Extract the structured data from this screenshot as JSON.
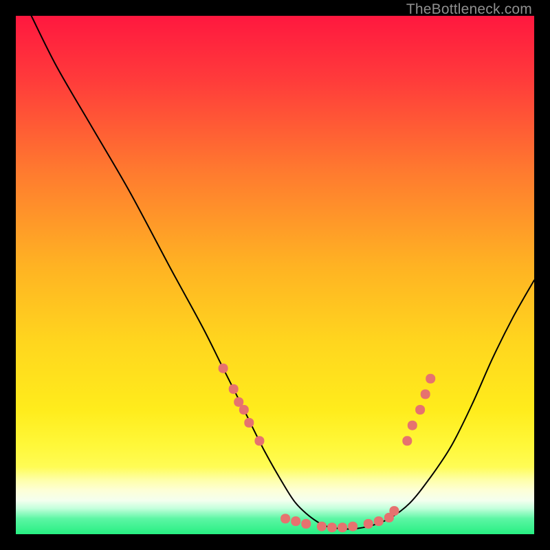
{
  "watermark": "TheBottleneck.com",
  "colors": {
    "background": "#000000",
    "gradient_top": "#ff183f",
    "gradient_mid1": "#ff6b2e",
    "gradient_mid2": "#ffc21f",
    "gradient_mid3": "#ffe61a",
    "gradient_bottom_yellow": "#fffc55",
    "gradient_pale": "#fdffd6",
    "gradient_green": "#27ef82",
    "curve_stroke": "#000000",
    "marker_fill": "#e6726f"
  },
  "chart_data": {
    "type": "line",
    "title": "",
    "xlabel": "",
    "ylabel": "",
    "xlim": [
      0,
      100
    ],
    "ylim": [
      0,
      100
    ],
    "series": [
      {
        "name": "curve",
        "x": [
          3,
          8,
          15,
          22,
          30,
          36,
          40,
          44,
          48,
          52,
          54,
          56,
          58,
          60,
          64,
          68,
          72,
          76,
          80,
          84,
          88,
          92,
          96,
          100
        ],
        "y": [
          100,
          90,
          78,
          66,
          51,
          40,
          32,
          24,
          16,
          9,
          6,
          4,
          2.5,
          1.5,
          1,
          1.5,
          3,
          6,
          11,
          17,
          25,
          34,
          42,
          49
        ]
      }
    ],
    "markers": [
      {
        "x": 40,
        "y": 32
      },
      {
        "x": 42,
        "y": 28
      },
      {
        "x": 43,
        "y": 25.5
      },
      {
        "x": 44,
        "y": 24
      },
      {
        "x": 45,
        "y": 21.5
      },
      {
        "x": 47,
        "y": 18
      },
      {
        "x": 52,
        "y": 3
      },
      {
        "x": 54,
        "y": 2.5
      },
      {
        "x": 56,
        "y": 2
      },
      {
        "x": 59,
        "y": 1.5
      },
      {
        "x": 61,
        "y": 1.3
      },
      {
        "x": 63,
        "y": 1.3
      },
      {
        "x": 65,
        "y": 1.5
      },
      {
        "x": 68,
        "y": 2
      },
      {
        "x": 70,
        "y": 2.5
      },
      {
        "x": 72,
        "y": 3.2
      },
      {
        "x": 73,
        "y": 4.5
      },
      {
        "x": 75.5,
        "y": 18
      },
      {
        "x": 76.5,
        "y": 21
      },
      {
        "x": 78,
        "y": 24
      },
      {
        "x": 79,
        "y": 27
      },
      {
        "x": 80,
        "y": 30
      }
    ]
  }
}
